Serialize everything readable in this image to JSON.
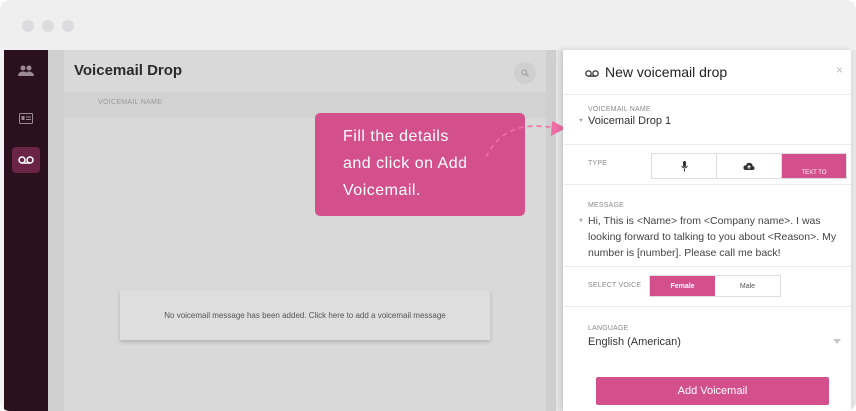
{
  "main": {
    "title": "Voicemail Drop",
    "column_header": "VOICEMAIL NAME",
    "empty_message": "No voicemail message has been added. Click here to add a voicemail message"
  },
  "tooltip": {
    "line1": "Fill the details",
    "line2": "and click on Add",
    "line3": "Voicemail."
  },
  "panel": {
    "title": "New voicemail drop",
    "close": "×",
    "name_label": "VOICEMAIL NAME",
    "name_value": "Voicemail Drop 1",
    "required_mark": "*",
    "type_label": "TYPE",
    "type_options": [
      "record",
      "upload",
      "TEXT TO"
    ],
    "message_label": "MESSAGE",
    "message_value": "Hi, This is <Name> from <Company name>. I was looking forward to talking to you about <Reason>. My number is [number]. Please call me back!",
    "voice_label": "SELECT VOICE",
    "voice_options": [
      "Female",
      "Male"
    ],
    "voice_selected": "Female",
    "language_label": "LANGUAGE",
    "language_value": "English (American)",
    "add_button": "Add Voicemail"
  },
  "colors": {
    "accent": "#d4508c",
    "sidebar": "#2b111d"
  },
  "icons": [
    "people-icon",
    "contact-card-icon",
    "voicemail-icon",
    "search-icon",
    "voicemail-icon",
    "microphone-icon",
    "cloud-upload-icon",
    "chevron-down-icon"
  ]
}
